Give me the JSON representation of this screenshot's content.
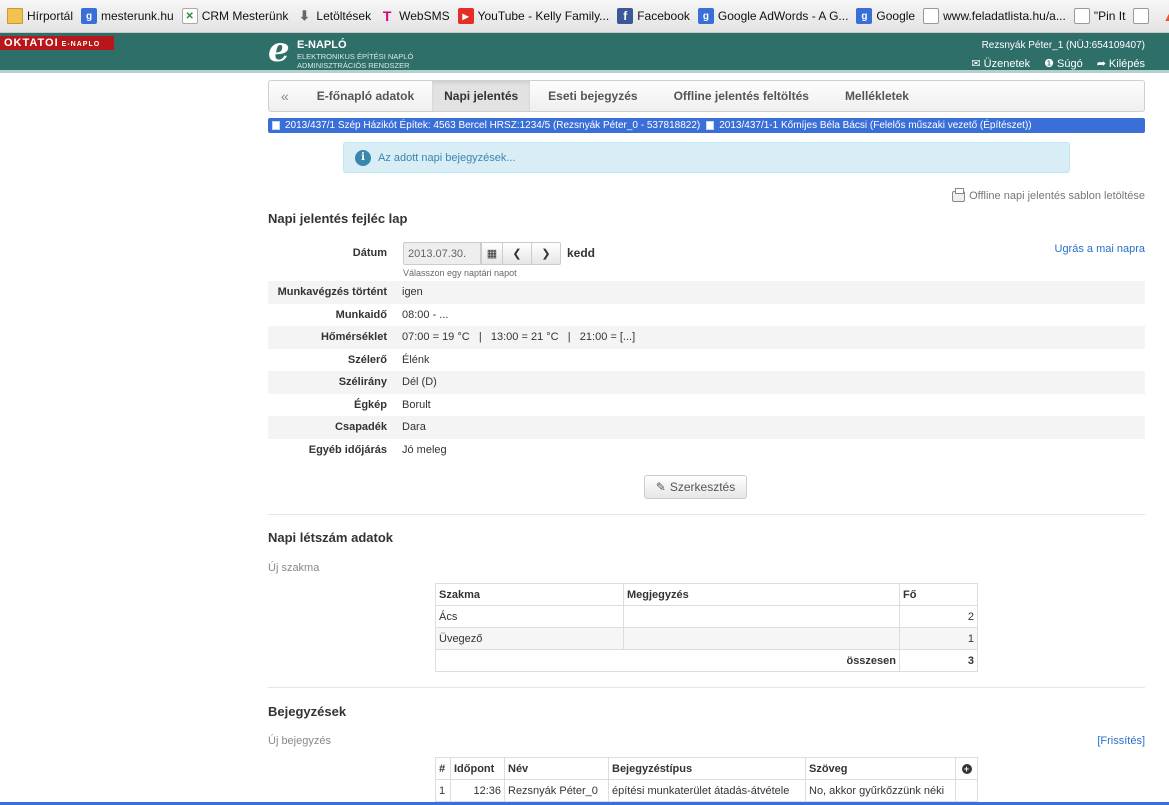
{
  "bookmarks": [
    {
      "icon": "folder-icon",
      "label": "Hírportál",
      "glyph": ""
    },
    {
      "icon": "google-icon",
      "label": "mesterunk.hu",
      "glyph": "g"
    },
    {
      "icon": "crm-icon",
      "label": "CRM Mesterünk",
      "glyph": "✕"
    },
    {
      "icon": "download-icon",
      "label": "Letöltések",
      "glyph": "⬇"
    },
    {
      "icon": "tmobile-icon",
      "label": "WebSMS",
      "glyph": "T"
    },
    {
      "icon": "youtube-icon",
      "label": "YouTube - Kelly Family...",
      "glyph": "▶"
    },
    {
      "icon": "facebook-icon",
      "label": "Facebook",
      "glyph": "f"
    },
    {
      "icon": "google-icon",
      "label": "Google AdWords - A G...",
      "glyph": "g"
    },
    {
      "icon": "google-icon",
      "label": "Google",
      "glyph": "g"
    },
    {
      "icon": "page-icon",
      "label": "www.feladatlista.hu/a...",
      "glyph": ""
    },
    {
      "icon": "page-icon",
      "label": "\"Pin It",
      "glyph": ""
    }
  ],
  "header": {
    "badge": "OKTATOI",
    "badge_small": "E-NAPLO",
    "logo_letter": "e",
    "logo_title": "E-NAPLÓ",
    "logo_sub1": "ELEKTRONIKUS ÉPÍTÉSI NAPLÓ",
    "logo_sub2": "ADMINISZTRÁCIÓS RENDSZER",
    "user": "Rezsnyák Péter_1 (NÜJ:654109407)",
    "messages": "Üzenetek",
    "help": "Súgó",
    "logout": "Kilépés"
  },
  "tabs": {
    "back": "«",
    "items": [
      "E-főnapló adatok",
      "Napi jelentés",
      "Eseti bejegyzés",
      "Offline jelentés feltöltés",
      "Mellékletek"
    ]
  },
  "project_bar": {
    "item1": "2013/437/1 Szép Házikót Építek: 4563 Bercel HRSZ:1234/5 (Rezsnyák Péter_0 - 537818822)",
    "item2": "2013/437/1-1 Kőmíjes Béla Bácsi (Felelős műszaki vezető (Építészet))"
  },
  "info": {
    "icon": "i",
    "text": "Az adott napi bejegyzések..."
  },
  "offline_template": "Offline napi jelentés sablon letöltése",
  "header_form": {
    "title": "Napi jelentés fejléc lap",
    "date_label": "Dátum",
    "date_value": "2013.07.30.",
    "day_name": "kedd",
    "date_help": "Válasszon egy naptári napot",
    "jump_today": "Ugrás a mai napra",
    "rows": [
      {
        "label": "Munkavégzés történt",
        "value": "igen"
      },
      {
        "label": "Munkaidő",
        "value": "08:00 - ..."
      },
      {
        "label": "Hőmérséklet",
        "value": "07:00 = 19 °C   |   13:00 = 21 °C   |   21:00 = [...]"
      },
      {
        "label": "Szélerő",
        "value": "Élénk"
      },
      {
        "label": "Szélirány",
        "value": "Dél (D)"
      },
      {
        "label": "Égkép",
        "value": "Borult"
      },
      {
        "label": "Csapadék",
        "value": "Dara"
      },
      {
        "label": "Egyéb időjárás",
        "value": "Jó meleg"
      }
    ],
    "edit_button": "Szerkesztés"
  },
  "headcount": {
    "title": "Napi létszám adatok",
    "new_link": "Új szakma",
    "columns": [
      "Szakma",
      "Megjegyzés",
      "Fő"
    ],
    "rows": [
      {
        "trade": "Ács",
        "note": "",
        "count": "2"
      },
      {
        "trade": "Üvegező",
        "note": "",
        "count": "1"
      }
    ],
    "total_label": "összesen",
    "total_value": "3"
  },
  "entries": {
    "title": "Bejegyzések",
    "new_link": "Új bejegyzés",
    "refresh": "[Frissítés]",
    "columns": [
      "#",
      "Időpont",
      "Név",
      "Bejegyzéstípus",
      "Szöveg"
    ],
    "rows": [
      {
        "no": "1",
        "time": "12:36",
        "name": "Rezsnyák Péter_0",
        "type": "építési munkaterület átadás-átvétele",
        "text": "No, akkor gyűrkőzzünk néki"
      }
    ]
  }
}
